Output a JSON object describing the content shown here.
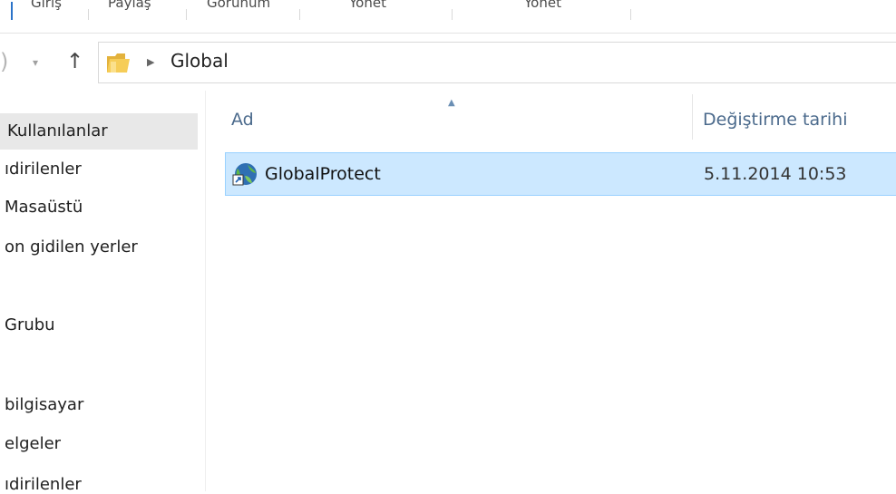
{
  "ribbon": {
    "tabs": [
      "Giriş",
      "Paylaş",
      "Görünüm",
      "Yönet",
      "Yönet"
    ]
  },
  "address": {
    "back_icon": "back-arrow-icon",
    "up_icon": "up-arrow-icon",
    "crumb": "Global"
  },
  "navpane": {
    "items": [
      "Kullanılanlar",
      "ıdirilenler",
      "Masaüstü",
      "on gidilen yerler",
      "Grubu",
      "bilgisayar",
      "elgeler",
      "ıdirilenler"
    ]
  },
  "columns": {
    "name": "Ad",
    "date": "Değiştirme tarihi"
  },
  "files": [
    {
      "name": "GlobalProtect",
      "date": "5.11.2014 10:53",
      "icon": "shortcut-globe-icon"
    }
  ],
  "colors": {
    "selection_bg": "#cce8ff",
    "selection_border": "#99d1ff",
    "header_text": "#4b6a8c"
  }
}
